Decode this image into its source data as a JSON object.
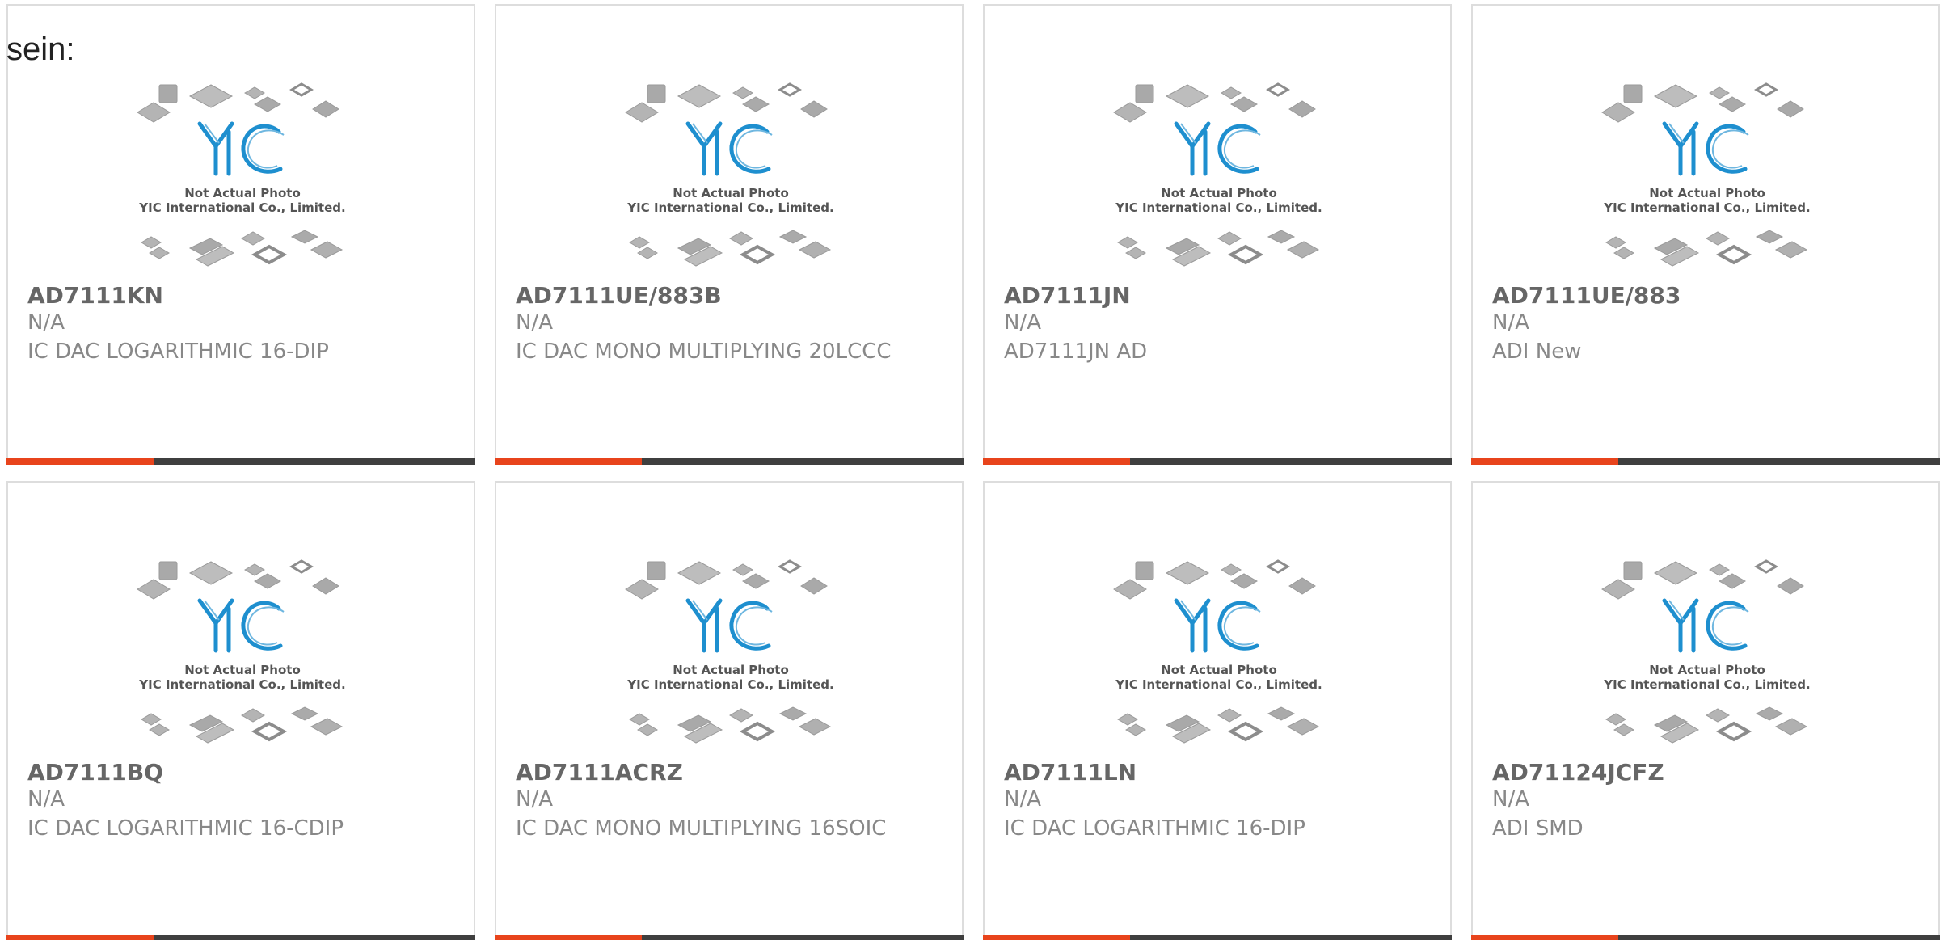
{
  "intro_text": "sein:",
  "colors": {
    "accent": "#e8441c",
    "bar": "#3f3f3f",
    "logo_blue": "#1e8fcf",
    "chip_gray": "#a8a8a8"
  },
  "placeholder": {
    "logo_text": "YIC",
    "caption_line1": "Not Actual Photo",
    "caption_line2": "YIC International Co., Limited."
  },
  "products": [
    {
      "part": "AD7111KN",
      "manufacturer": "N/A",
      "description": "IC DAC LOGARITHMIC 16-DIP"
    },
    {
      "part": "AD7111UE/883B",
      "manufacturer": "N/A",
      "description": "IC DAC MONO MULTIPLYING 20LCCC"
    },
    {
      "part": "AD7111JN",
      "manufacturer": "N/A",
      "description": "AD7111JN AD"
    },
    {
      "part": "AD7111UE/883",
      "manufacturer": "N/A",
      "description": "ADI New"
    },
    {
      "part": "AD7111BQ",
      "manufacturer": "N/A",
      "description": "IC DAC LOGARITHMIC 16-CDIP"
    },
    {
      "part": "AD7111ACRZ",
      "manufacturer": "N/A",
      "description": "IC DAC MONO MULTIPLYING 16SOIC"
    },
    {
      "part": "AD7111LN",
      "manufacturer": "N/A",
      "description": "IC DAC LOGARITHMIC 16-DIP"
    },
    {
      "part": "AD71124JCFZ",
      "manufacturer": "N/A",
      "description": "ADI SMD"
    }
  ]
}
